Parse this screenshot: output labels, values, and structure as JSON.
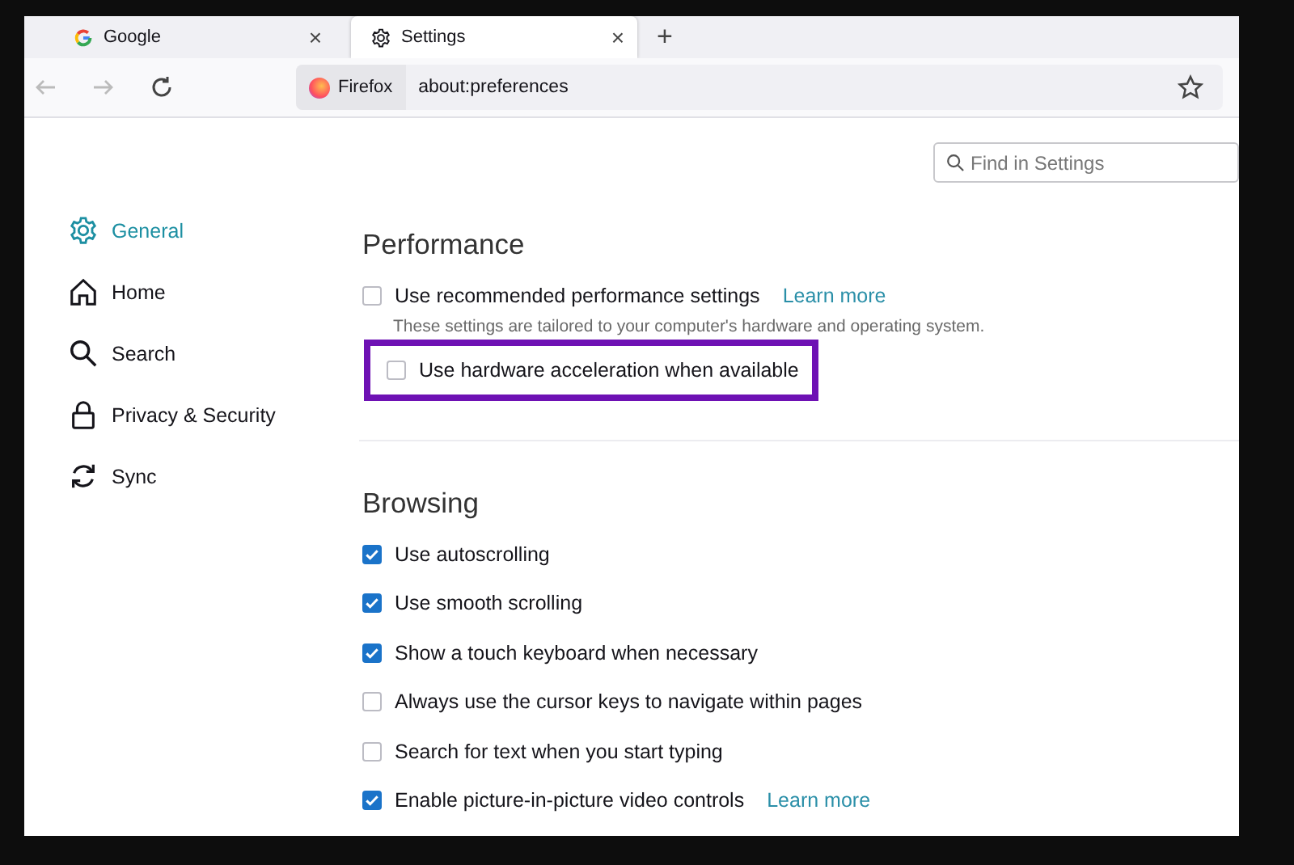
{
  "tabs": [
    {
      "label": "Google",
      "kind": "google",
      "close": "×",
      "selected": false
    },
    {
      "label": "Settings",
      "kind": "gear",
      "close": "×",
      "selected": true
    }
  ],
  "new_tab": "+",
  "nav": {
    "identity": "Firefox",
    "url": "about:preferences"
  },
  "search": {
    "placeholder": "Find in Settings"
  },
  "sidebar": {
    "items": [
      {
        "label": "General",
        "kind": "gear",
        "selected": true
      },
      {
        "label": "Home",
        "kind": "home",
        "selected": false
      },
      {
        "label": "Search",
        "kind": "search",
        "selected": false
      },
      {
        "label": "Privacy & Security",
        "kind": "lock",
        "selected": false
      },
      {
        "label": "Sync",
        "kind": "sync",
        "selected": false
      }
    ]
  },
  "sections": [
    {
      "title": "Performance",
      "options": [
        {
          "label": "Use recommended performance settings",
          "checked": false,
          "link": "Learn more",
          "note": "These settings are tailored to your computer's hardware and operating system."
        },
        {
          "label": "Use hardware acceleration when available",
          "checked": false,
          "highlighted": true
        }
      ]
    },
    {
      "title": "Browsing",
      "options": [
        {
          "label": "Use autoscrolling",
          "checked": true
        },
        {
          "label": "Use smooth scrolling",
          "checked": true
        },
        {
          "label": "Show a touch keyboard when necessary",
          "checked": true
        },
        {
          "label": "Always use the cursor keys to navigate within pages",
          "checked": false
        },
        {
          "label": "Search for text when you start typing",
          "checked": false
        },
        {
          "label": "Enable picture-in-picture video controls",
          "checked": true,
          "link": "Learn more"
        }
      ]
    }
  ]
}
